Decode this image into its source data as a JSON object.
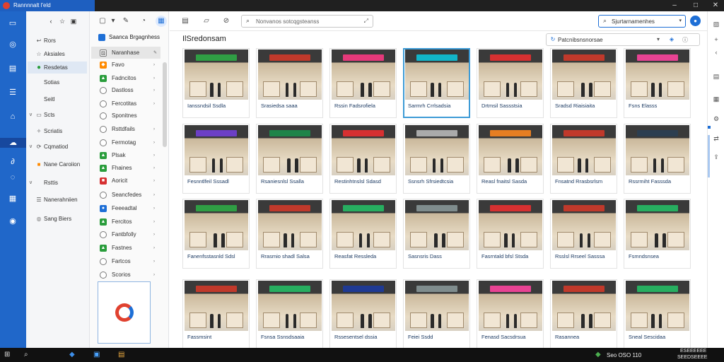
{
  "window": {
    "title": "Rannnnalt l'eld",
    "controls": [
      "minimize-icon",
      "maximize-icon",
      "close-icon"
    ]
  },
  "rail": {
    "icons": [
      "monitor-icon",
      "target-icon",
      "clipboard-icon",
      "document-icon",
      "building-icon",
      "cloud-icon",
      "link-icon",
      "chat-icon",
      "grid-icon",
      "globe-icon"
    ],
    "selected_index": 5
  },
  "nav": {
    "top_buttons": [
      "back-icon",
      "star-icon",
      "dashboard-icon"
    ],
    "items": [
      {
        "label": "Rors",
        "arrow": "",
        "icon": "back-arrow-icon"
      },
      {
        "label": "Aksiales",
        "arrow": "",
        "icon": "star-icon"
      },
      {
        "label": "Resdetas",
        "arrow": "",
        "icon": "green-circle-icon",
        "selected": true
      },
      {
        "label": "Sotias",
        "arrow": "",
        "icon": ""
      },
      {
        "label": "Seitl",
        "arrow": "",
        "icon": ""
      },
      {
        "label": "Scts",
        "arrow": "v",
        "icon": "folder-icon"
      },
      {
        "label": "Scriatis",
        "arrow": "",
        "icon": "sparkle-icon"
      },
      {
        "label": "Cqmatiod",
        "arrow": "v",
        "icon": "refresh-icon"
      },
      {
        "label": "Nane Caroiion",
        "arrow": "",
        "icon": "orange-square-icon"
      },
      {
        "label": "Rsttis",
        "arrow": "v",
        "icon": ""
      },
      {
        "label": "Nanerahniien",
        "arrow": "",
        "icon": "list-icon"
      },
      {
        "label": "Sang Biers",
        "arrow": "",
        "icon": "globe-icon"
      }
    ]
  },
  "mid": {
    "header": "Saanca Brgagnhess",
    "items": [
      {
        "label": "Naranhase",
        "icon": "image-icon",
        "selected": true,
        "chev": "pen-icon"
      },
      {
        "label": "Favo",
        "icon": "orange",
        "chev": "›"
      },
      {
        "label": "Fadncitos",
        "icon": "green",
        "chev": "›"
      },
      {
        "label": "Dastloss",
        "icon": "circle",
        "chev": "›"
      },
      {
        "label": "Fercotitas",
        "icon": "circle",
        "chev": "›"
      },
      {
        "label": "Sponitnes",
        "icon": "circle",
        "chev": ""
      },
      {
        "label": "Rsttdfails",
        "icon": "circle",
        "chev": "›"
      },
      {
        "label": "Fermotag",
        "icon": "circle",
        "chev": "›"
      },
      {
        "label": "Plsak",
        "icon": "green",
        "chev": "›"
      },
      {
        "label": "Fhaines",
        "icon": "green",
        "chev": "›"
      },
      {
        "label": "Aoricit",
        "icon": "red",
        "chev": "›"
      },
      {
        "label": "Seancfedes",
        "icon": "circle",
        "chev": "›"
      },
      {
        "label": "Feeeadtal",
        "icon": "blue",
        "chev": "›"
      },
      {
        "label": "Fercitos",
        "icon": "green",
        "chev": "›"
      },
      {
        "label": "Fantbfolly",
        "icon": "circle",
        "chev": "›"
      },
      {
        "label": "Fastnes",
        "icon": "green",
        "chev": "›"
      },
      {
        "label": "Fartcos",
        "icon": "circle",
        "chev": "›"
      },
      {
        "label": "Scorios",
        "icon": "circle",
        "chev": "›"
      }
    ]
  },
  "toolbar": {
    "search_placeholder": "Nonvanos sotcqgsteanss",
    "search2_text": "Sjurtarnamenhes",
    "left_icons": [
      "new-document-icon",
      "chevron-down-icon",
      "edit-icon",
      "shield-icon",
      "calendar-icon"
    ],
    "mid_icons": [
      "grid-view-icon",
      "folder-icon",
      "paperclip-icon"
    ]
  },
  "content": {
    "heading": "IlSredonsam",
    "viewbar_text": "Patcnibsnsnorsae",
    "viewbar_icons": [
      "filter-icon",
      "lock-icon",
      "info-icon"
    ]
  },
  "cards": [
    {
      "caption": "Ianssndsil Ssdla",
      "sign": "#2f9e44",
      "row": 0
    },
    {
      "caption": "Srasiedsa saaa",
      "sign": "#c0392b",
      "row": 0
    },
    {
      "caption": "Rssin Fadsrofiela",
      "sign": "#e5397a",
      "row": 0
    },
    {
      "caption": "Sarmrh Crrlsadsia",
      "sign": "#12b5c9",
      "row": 0,
      "selected": true
    },
    {
      "caption": "Drtmsil Sassstsia",
      "sign": "#d63031",
      "row": 0
    },
    {
      "caption": "Sradsd Riaisiaita",
      "sign": "#c0392b",
      "row": 0
    },
    {
      "caption": "Fsns Elasss",
      "sign": "#e84393",
      "row": 0
    },
    {
      "caption": "Fesnntlfeil Sssadl",
      "sign": "#6c3fc5",
      "row": 1
    },
    {
      "caption": "Rsaniesnlsl Ssalla",
      "sign": "#1e8449",
      "row": 1
    },
    {
      "caption": "Restinhtnslsl Sdasd",
      "sign": "#d63031",
      "row": 1
    },
    {
      "caption": "Ssnsrh Sfrsiedtcsia",
      "sign": "#aaaaaa",
      "row": 1
    },
    {
      "caption": "Reasl fnaitsl Sasda",
      "sign": "#e67e22",
      "row": 1
    },
    {
      "caption": "Fnsatnd Rrasbsrlsm",
      "sign": "#c0392b",
      "row": 1
    },
    {
      "caption": "Rssrmiht Fasssda",
      "sign": "#2c3e50",
      "row": 1
    },
    {
      "caption": "Fanenfsstasnld Sdsl",
      "sign": "#2f9e44",
      "row": 2
    },
    {
      "caption": "Rrasmio shadl Salsa",
      "sign": "#c0392b",
      "row": 2
    },
    {
      "caption": "Reasfat Ressleda",
      "sign": "#27ae60",
      "row": 2
    },
    {
      "caption": "Sasnsris Dass",
      "sign": "#7f8c8d",
      "row": 2
    },
    {
      "caption": "Fasrntald bfsl Stsda",
      "sign": "#d63031",
      "row": 2
    },
    {
      "caption": "Rsslsl Rrseel Sasssa",
      "sign": "#c0392b",
      "row": 2
    },
    {
      "caption": "Fsmndsnsea",
      "sign": "#27ae60",
      "row": 2
    },
    {
      "caption": "Fassmsint",
      "sign": "#c0392b",
      "row": 3
    },
    {
      "caption": "Fsnsa Ssnsdsaaia",
      "sign": "#27ae60",
      "row": 3
    },
    {
      "caption": "Rssesentsel dssia",
      "sign": "#1f3a93",
      "row": 3
    },
    {
      "caption": "Feiei Ssdd",
      "sign": "#7f8c8d",
      "row": 3
    },
    {
      "caption": "Fenasd Sacsdrsua",
      "sign": "#e84393",
      "row": 3
    },
    {
      "caption": "Rasannea",
      "sign": "#c0392b",
      "row": 3
    },
    {
      "caption": "Sneal Sescidaa",
      "sign": "#27ae60",
      "row": 3
    }
  ],
  "rightbar": {
    "icons": [
      "image-icon",
      "plus-icon",
      "chevron-left-icon",
      "table-icon",
      "gear-icon",
      "translate-icon",
      "share-icon"
    ]
  },
  "taskbar": {
    "icons": [
      "start-icon",
      "search-icon",
      "vscode-icon",
      "files-icon",
      "store-icon"
    ],
    "tray_text": "Seo OSO 110",
    "clock_line1": "ESEEEEEE",
    "clock_line2": "SEEDSEEEE"
  }
}
